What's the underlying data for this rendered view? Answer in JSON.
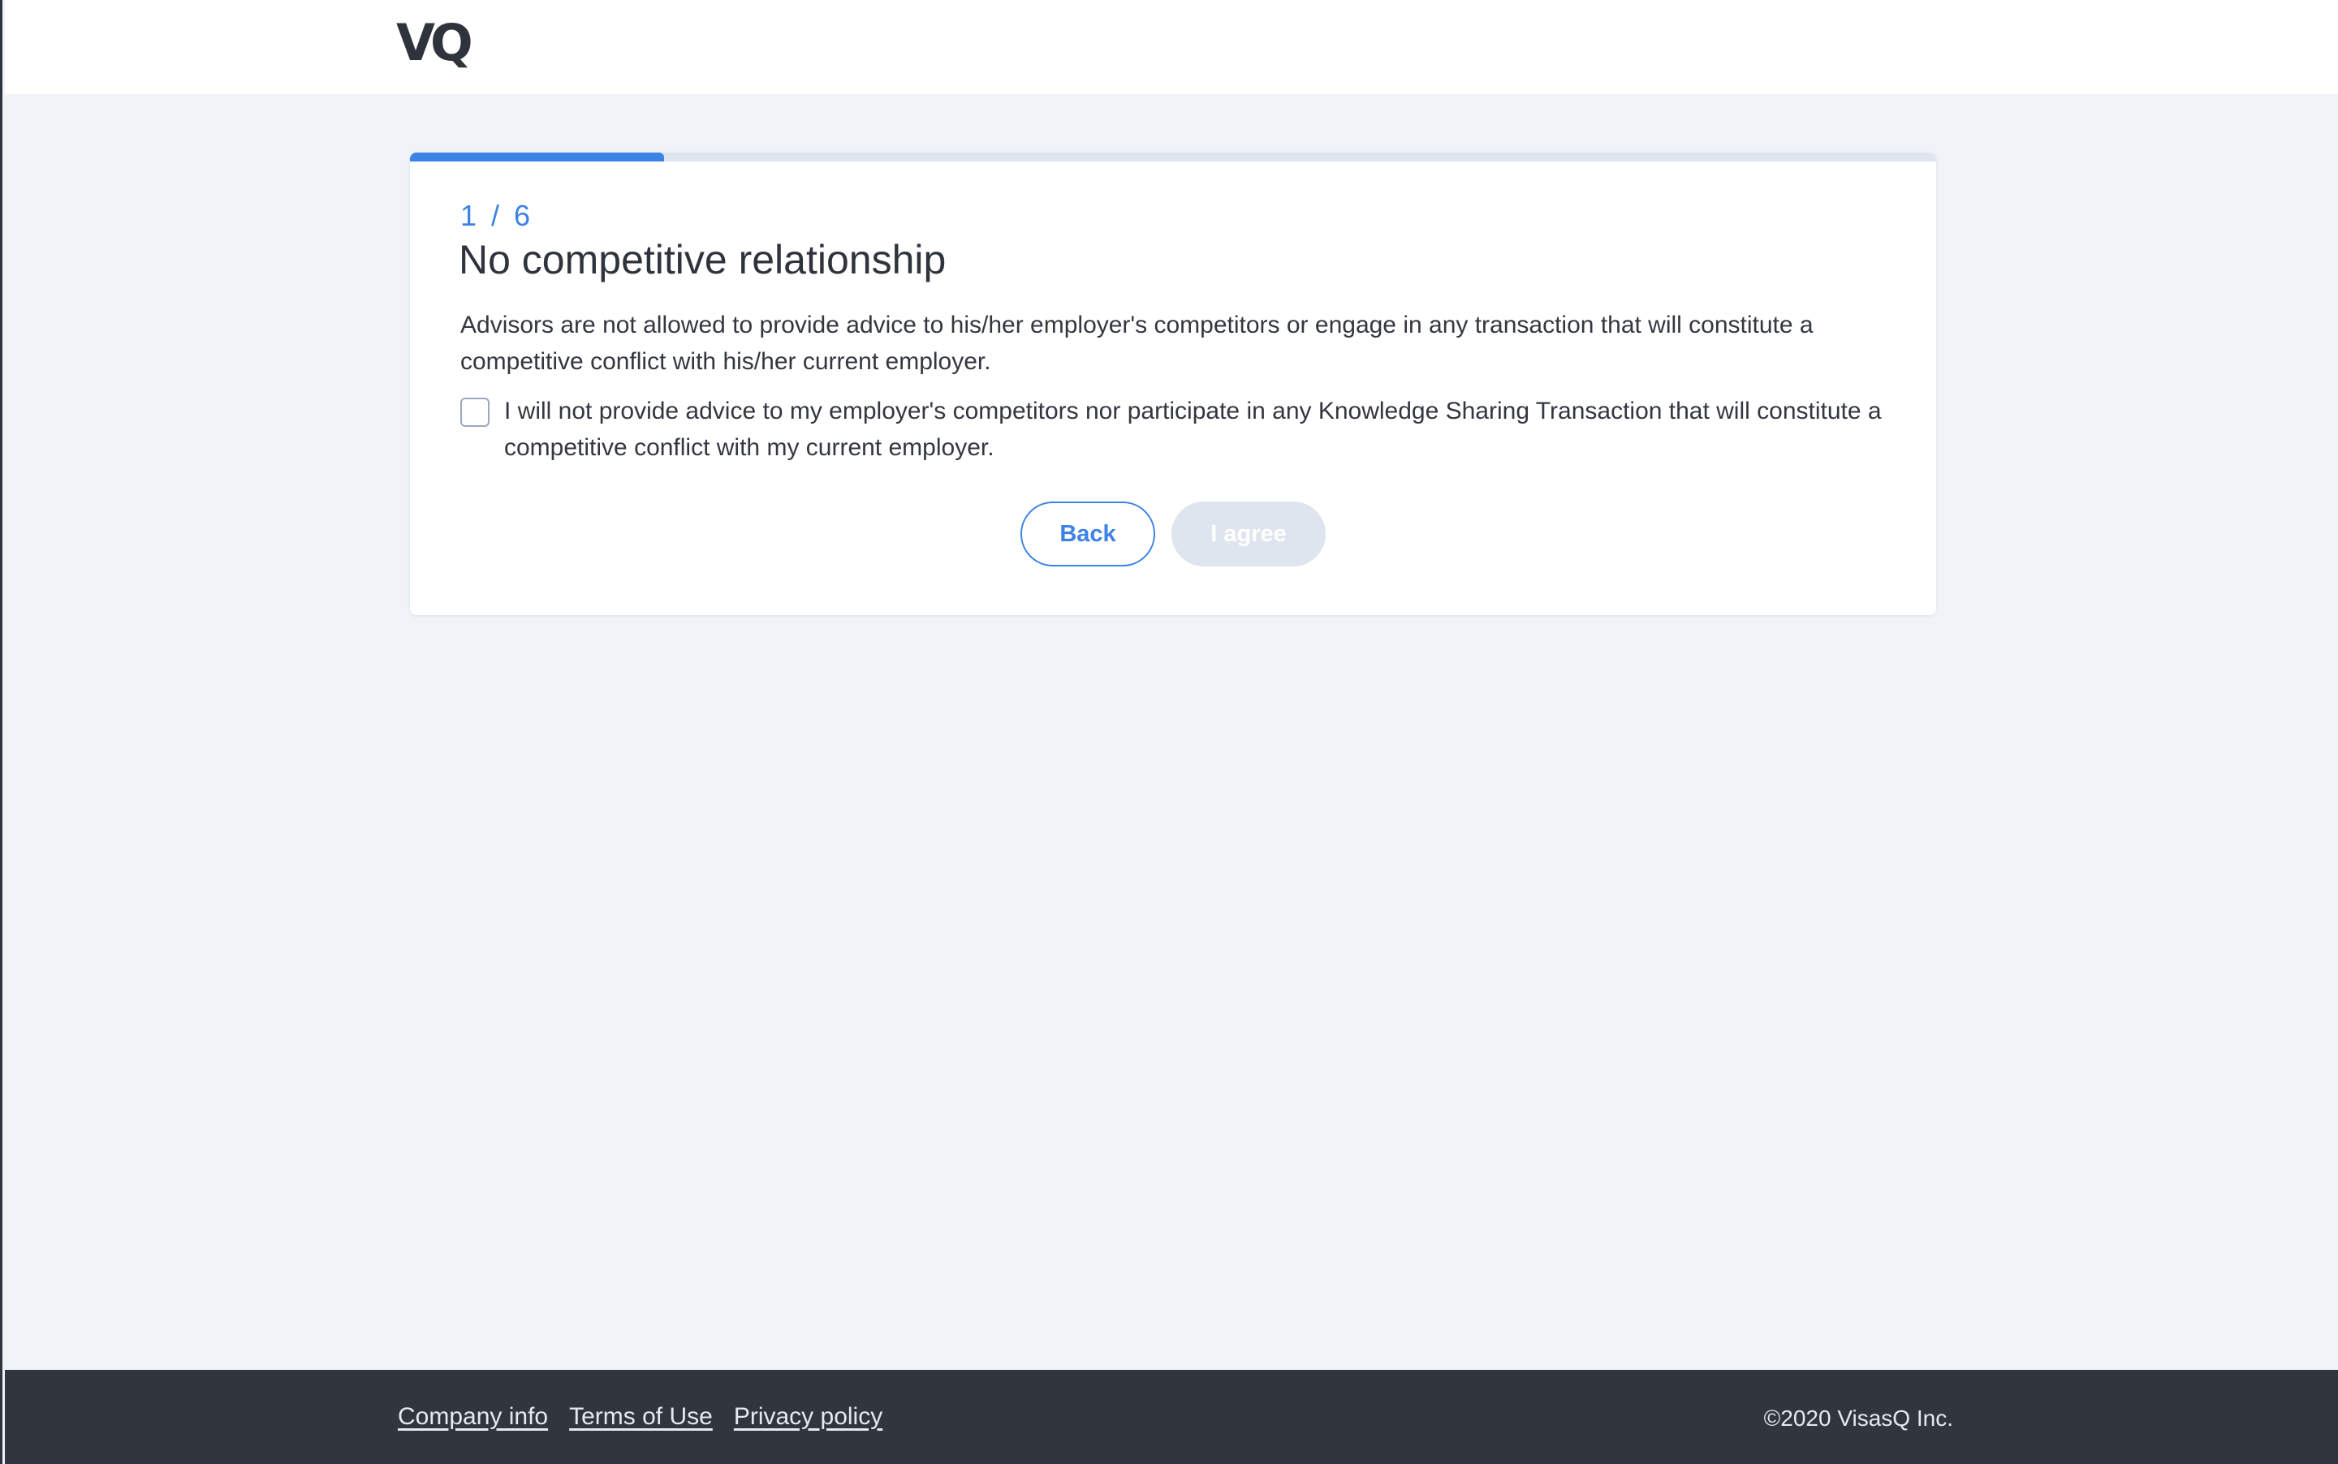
{
  "header": {
    "logo_text": "VQ"
  },
  "progress": {
    "current_step": 1,
    "total_steps": 6,
    "fraction": 0.1667,
    "color": "#3d82e5"
  },
  "card": {
    "step_label": "1 / 6",
    "title": "No competitive relationship",
    "description": "Advisors are not allowed to provide advice to his/her employer's competitors or engage in any transaction that will constitute a competitive conflict with his/her current employer.",
    "checkbox": {
      "checked": false,
      "label": "I will not provide advice to my employer's competitors nor participate in any Knowledge Sharing Transaction that will constitute a competitive conflict with my current employer."
    },
    "buttons": {
      "back_label": "Back",
      "agree_label": "I agree",
      "agree_disabled": true
    }
  },
  "footer": {
    "links": [
      "Company info",
      "Terms of Use",
      "Privacy policy"
    ],
    "copyright": "©2020 VisasQ Inc."
  },
  "colors": {
    "accent": "#3d82e5",
    "page_background": "#f0f4f8",
    "footer_background": "#31353d",
    "disabled_button": "#dfe5ee"
  }
}
